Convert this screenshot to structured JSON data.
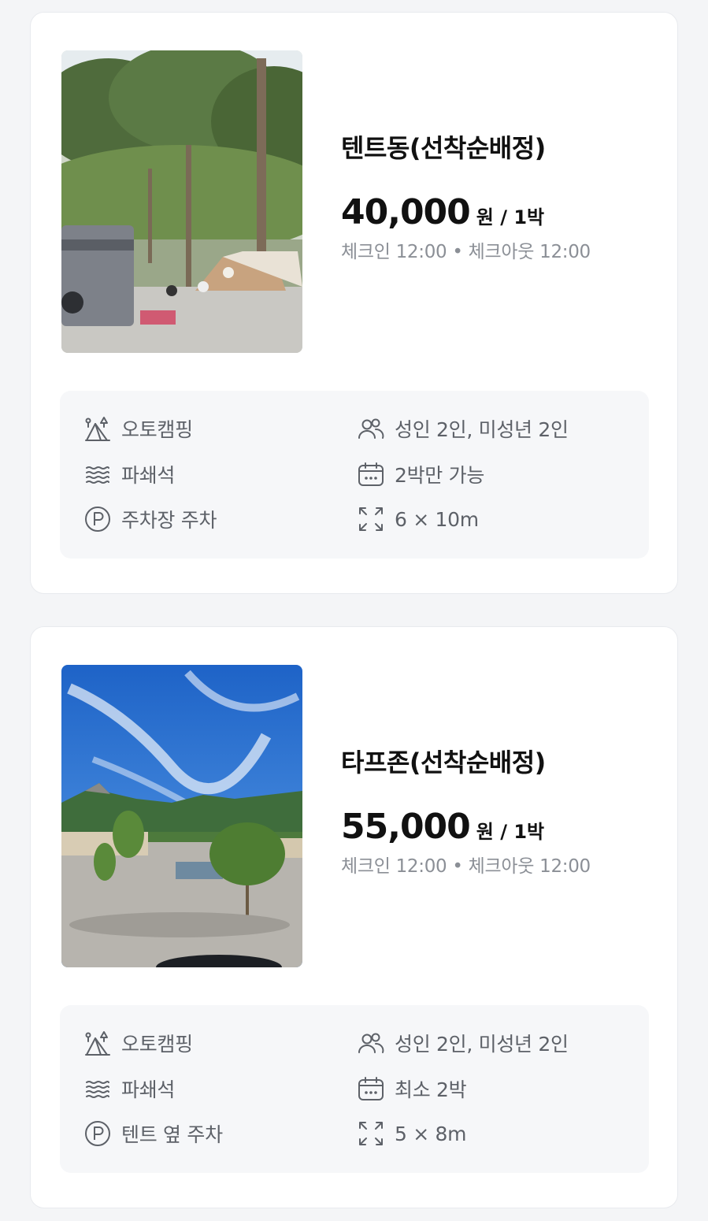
{
  "sites": [
    {
      "title": "텐트동(선착순배정)",
      "price": "40,000",
      "per_night": "원 / 1박",
      "checkin": "체크인 12:00 • 체크아웃 12:00",
      "type": "오토캠핑",
      "ground": "파쇄석",
      "parking": "주차장 주차",
      "capacity": "성인 2인, 미성년 2인",
      "stay": "2박만 가능",
      "size": "6 × 10m"
    },
    {
      "title": "타프존(선착순배정)",
      "price": "55,000",
      "per_night": "원 / 1박",
      "checkin": "체크인 12:00 • 체크아웃 12:00",
      "type": "오토캠핑",
      "ground": "파쇄석",
      "parking": "텐트 옆 주차",
      "capacity": "성인 2인, 미성년 2인",
      "stay": "최소 2박",
      "size": "5 × 8m"
    }
  ],
  "icons": {
    "type": "tent-trees-icon",
    "ground": "gravel-icon",
    "parking": "parking-icon",
    "capacity": "people-icon",
    "stay": "calendar-icon",
    "size": "expand-icon"
  }
}
